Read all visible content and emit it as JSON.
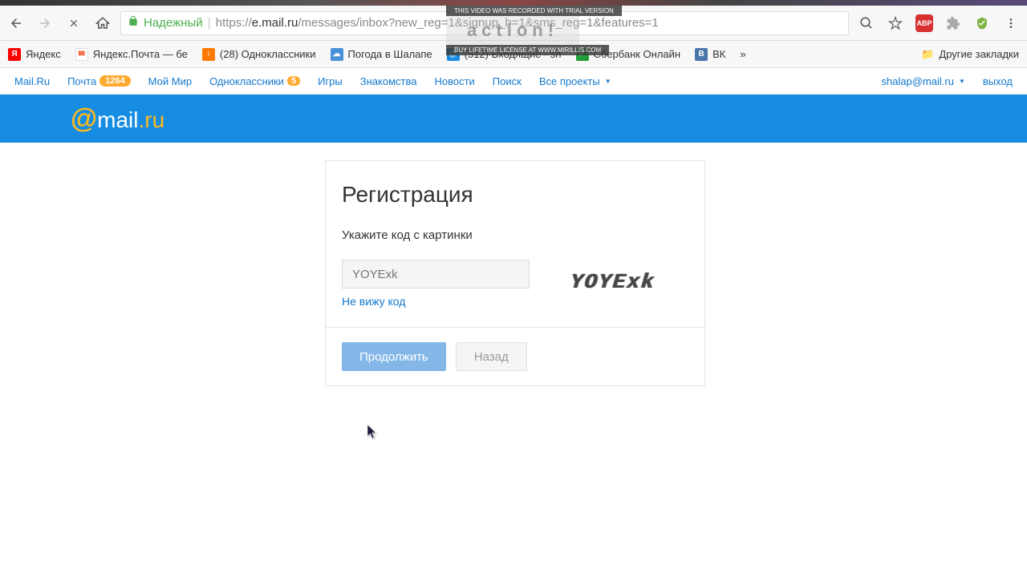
{
  "browser": {
    "secure_label": "Надежный",
    "url_prefix": "https://",
    "url_host": "e.mail.ru",
    "url_path": "/messages/inbox?new_reg=1&signup_b=1&sms_reg=1&features=1"
  },
  "bookmarks": {
    "yandex": "Яндекс",
    "yandex_mail": "Яндекс.Почта — бе",
    "odnoklassniki": "(28) Одноклассники",
    "weather": "Погода в Шалапе",
    "inbox": "(512) Входящие - sh",
    "sberbank": "Сбербанк Онлайн",
    "vk": "ВК",
    "more": "»",
    "other": "Другие закладки"
  },
  "portal": {
    "mailru": "Mail.Ru",
    "mail": "Почта",
    "mail_badge": "1264",
    "myworld": "Мой Мир",
    "ok": "Одноклассники",
    "ok_badge": "5",
    "games": "Игры",
    "dating": "Знакомства",
    "news": "Новости",
    "search": "Поиск",
    "projects": "Все проекты",
    "user_email": "shalap@mail.ru",
    "logout": "выход"
  },
  "card": {
    "title": "Регистрация",
    "subtitle": "Укажите код с картинки",
    "captcha_placeholder": "YOYExk",
    "captcha_text": "YOYExk",
    "cant_see": "Не вижу код",
    "continue": "Продолжить",
    "back": "Назад"
  },
  "watermark": {
    "line1": "THIS VIDEO WAS RECORDED WITH TRIAL VERSION",
    "line2": "BUY LIFETIME LICENSE AT WWW.MIRILLIS.COM",
    "brand": "action!"
  }
}
